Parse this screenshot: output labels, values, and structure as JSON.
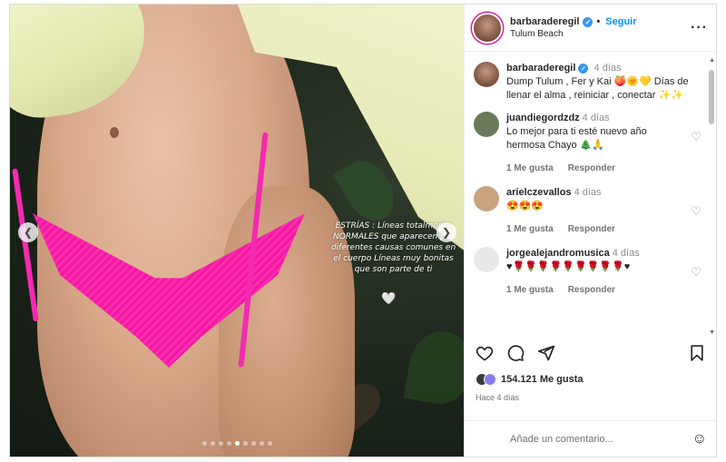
{
  "post": {
    "username": "barbaraderegil",
    "follow_label": "Seguir",
    "location": "Tulum Beach",
    "more_icon": "more-horizontal-icon"
  },
  "media": {
    "overlay_text": "ESTRÍAS : Líneas totalmente NORMALES que aparecen por diferentes causas comunes en el cuerpo Líneas muy bonitas que son parte de ti",
    "overlay_heart": "🤍",
    "slide_count": 9,
    "active_slide": 4
  },
  "caption": {
    "username": "barbaraderegil",
    "time": "4 días",
    "text": "Dump Tulum , Fer y Kai 🍑🌞💛 Días de llenar el alma , reiniciar , conectar ✨✨"
  },
  "comments": [
    {
      "username": "juandiegordzdz",
      "time": "4 días",
      "text": "Lo mejor para ti esté nuevo año hermosa Chayo 🎄🙏",
      "likes": "1 Me gusta",
      "reply": "Responder"
    },
    {
      "username": "arielczevallos",
      "time": "4 días",
      "text": "😍😍😍",
      "likes": "1 Me gusta",
      "reply": "Responder"
    },
    {
      "username": "jorgealejandromusica",
      "time": "4 días",
      "text": "♥🌹🌹🌹🌹🌹🌹🌹🌹🌹♥",
      "likes": "1 Me gusta",
      "reply": "Responder"
    }
  ],
  "footer": {
    "likes": "154.121 Me gusta",
    "posted": "Hace 4 días",
    "comment_placeholder": "Añade un comentario..."
  },
  "colors": {
    "accent": "#0095f6",
    "verified": "#3897f0",
    "bikini": "#ff2bb0"
  }
}
